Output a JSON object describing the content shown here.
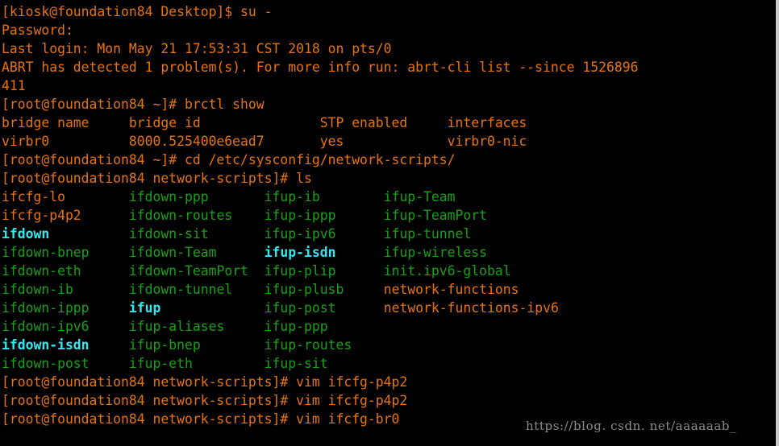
{
  "terminal": {
    "colors": {
      "background": "#000000",
      "prompt_orange": "#e8730c",
      "file_orange": "#e8730c",
      "exec_green": "#17a115",
      "symlink_cyan": "#31e9f1",
      "watermark_gray": "#8d8d8d",
      "border_gray": "#c9c9c9"
    },
    "lines": [
      {
        "id": "l01",
        "segments": [
          {
            "text": "[kiosk@foundation84 Desktop]$ su -",
            "color": "orange"
          }
        ]
      },
      {
        "id": "l02",
        "segments": [
          {
            "text": "Password:",
            "color": "orange"
          }
        ]
      },
      {
        "id": "l03",
        "segments": [
          {
            "text": "Last login: Mon May 21 17:53:31 CST 2018 on pts/0",
            "color": "orange"
          }
        ]
      },
      {
        "id": "l04",
        "segments": [
          {
            "text": "ABRT has detected 1 problem(s). For more info run: abrt-cli list --since 1526896",
            "color": "orange"
          }
        ]
      },
      {
        "id": "l05",
        "segments": [
          {
            "text": "411",
            "color": "orange"
          }
        ]
      },
      {
        "id": "l06",
        "segments": [
          {
            "text": "[root@foundation84 ~]# brctl show",
            "color": "orange"
          }
        ]
      },
      {
        "id": "l07",
        "segments": [
          {
            "text": "bridge name     bridge id               STP enabled     interfaces",
            "color": "orange"
          }
        ]
      },
      {
        "id": "l08",
        "segments": [
          {
            "text": "virbr0          8000.525400e6ead7       yes             virbr0-nic",
            "color": "orange"
          }
        ]
      },
      {
        "id": "l09",
        "segments": [
          {
            "text": "[root@foundation84 ~]# cd /etc/sysconfig/network-scripts/",
            "color": "orange"
          }
        ]
      },
      {
        "id": "l10",
        "segments": [
          {
            "text": "[root@foundation84 network-scripts]# ls",
            "color": "orange"
          }
        ]
      },
      {
        "id": "l11",
        "segments": [
          {
            "text": "ifcfg-lo",
            "color": "orange"
          },
          {
            "text": "        ",
            "color": "plain"
          },
          {
            "text": "ifdown-ppp",
            "color": "green"
          },
          {
            "text": "       ",
            "color": "plain"
          },
          {
            "text": "ifup-ib",
            "color": "green"
          },
          {
            "text": "        ",
            "color": "plain"
          },
          {
            "text": "ifup-Team",
            "color": "green"
          }
        ]
      },
      {
        "id": "l12",
        "segments": [
          {
            "text": "ifcfg-p4p2",
            "color": "orange"
          },
          {
            "text": "      ",
            "color": "plain"
          },
          {
            "text": "ifdown-routes",
            "color": "green"
          },
          {
            "text": "    ",
            "color": "plain"
          },
          {
            "text": "ifup-ippp",
            "color": "green"
          },
          {
            "text": "      ",
            "color": "plain"
          },
          {
            "text": "ifup-TeamPort",
            "color": "green"
          }
        ]
      },
      {
        "id": "l13",
        "segments": [
          {
            "text": "ifdown",
            "color": "cyan"
          },
          {
            "text": "          ",
            "color": "plain"
          },
          {
            "text": "ifdown-sit",
            "color": "green"
          },
          {
            "text": "       ",
            "color": "plain"
          },
          {
            "text": "ifup-ipv6",
            "color": "green"
          },
          {
            "text": "      ",
            "color": "plain"
          },
          {
            "text": "ifup-tunnel",
            "color": "green"
          }
        ]
      },
      {
        "id": "l14",
        "segments": [
          {
            "text": "ifdown-bnep",
            "color": "green"
          },
          {
            "text": "     ",
            "color": "plain"
          },
          {
            "text": "ifdown-Team",
            "color": "green"
          },
          {
            "text": "      ",
            "color": "plain"
          },
          {
            "text": "ifup-isdn",
            "color": "cyan"
          },
          {
            "text": "      ",
            "color": "plain"
          },
          {
            "text": "ifup-wireless",
            "color": "green"
          }
        ]
      },
      {
        "id": "l15",
        "segments": [
          {
            "text": "ifdown-eth",
            "color": "green"
          },
          {
            "text": "      ",
            "color": "plain"
          },
          {
            "text": "ifdown-TeamPort",
            "color": "green"
          },
          {
            "text": "  ",
            "color": "plain"
          },
          {
            "text": "ifup-plip",
            "color": "green"
          },
          {
            "text": "      ",
            "color": "plain"
          },
          {
            "text": "init.ipv6-global",
            "color": "green"
          }
        ]
      },
      {
        "id": "l16",
        "segments": [
          {
            "text": "ifdown-ib",
            "color": "green"
          },
          {
            "text": "       ",
            "color": "plain"
          },
          {
            "text": "ifdown-tunnel",
            "color": "green"
          },
          {
            "text": "    ",
            "color": "plain"
          },
          {
            "text": "ifup-plusb",
            "color": "green"
          },
          {
            "text": "     ",
            "color": "plain"
          },
          {
            "text": "network-functions",
            "color": "orange"
          }
        ]
      },
      {
        "id": "l17",
        "segments": [
          {
            "text": "ifdown-ippp",
            "color": "green"
          },
          {
            "text": "     ",
            "color": "plain"
          },
          {
            "text": "ifup",
            "color": "cyan"
          },
          {
            "text": "             ",
            "color": "plain"
          },
          {
            "text": "ifup-post",
            "color": "green"
          },
          {
            "text": "      ",
            "color": "plain"
          },
          {
            "text": "network-functions-ipv6",
            "color": "orange"
          }
        ]
      },
      {
        "id": "l18",
        "segments": [
          {
            "text": "ifdown-ipv6",
            "color": "green"
          },
          {
            "text": "     ",
            "color": "plain"
          },
          {
            "text": "ifup-aliases",
            "color": "green"
          },
          {
            "text": "     ",
            "color": "plain"
          },
          {
            "text": "ifup-ppp",
            "color": "green"
          }
        ]
      },
      {
        "id": "l19",
        "segments": [
          {
            "text": "ifdown-isdn",
            "color": "cyan"
          },
          {
            "text": "     ",
            "color": "plain"
          },
          {
            "text": "ifup-bnep",
            "color": "green"
          },
          {
            "text": "        ",
            "color": "plain"
          },
          {
            "text": "ifup-routes",
            "color": "green"
          }
        ]
      },
      {
        "id": "l20",
        "segments": [
          {
            "text": "ifdown-post",
            "color": "green"
          },
          {
            "text": "     ",
            "color": "plain"
          },
          {
            "text": "ifup-eth",
            "color": "green"
          },
          {
            "text": "         ",
            "color": "plain"
          },
          {
            "text": "ifup-sit",
            "color": "green"
          }
        ]
      },
      {
        "id": "l21",
        "segments": [
          {
            "text": "[root@foundation84 network-scripts]# vim ifcfg-p4p2",
            "color": "orange"
          }
        ]
      },
      {
        "id": "l22",
        "segments": [
          {
            "text": "[root@foundation84 network-scripts]# vim ifcfg-p4p2",
            "color": "orange"
          }
        ]
      },
      {
        "id": "l23",
        "segments": [
          {
            "text": "[root@foundation84 network-scripts]# vim ifcfg-br0",
            "color": "orange"
          }
        ]
      }
    ],
    "watermark": "https://blog. csdn. net/aaaaaab_"
  }
}
